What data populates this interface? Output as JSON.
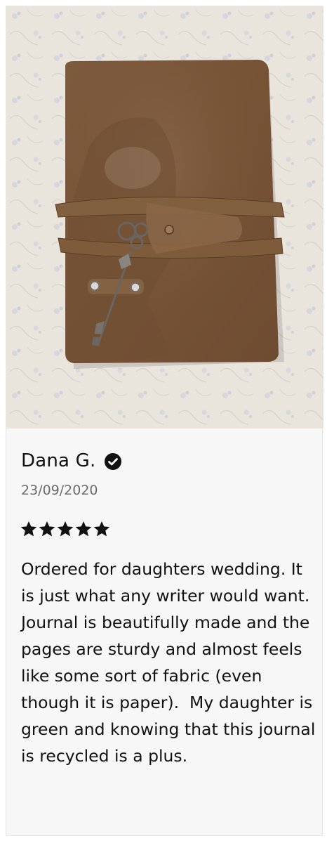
{
  "review": {
    "photo_alt": "Brown leather journal with key wrap",
    "reviewer_name": "Dana G.",
    "verified_icon": "verified-check-icon",
    "date": "23/09/2020",
    "rating": 5,
    "rating_max": 5,
    "star_icon": "star-icon",
    "body": "Ordered for daughters wedding. It is just what any writer would want. Journal is beautifully made and the pages are sturdy and almost feels like some sort of fabric (even though it is paper).  My daughter is green and knowing that this journal is recycled is a plus."
  },
  "colors": {
    "card_bg": "#f7f7f7",
    "text": "#111111",
    "date": "#6b6b6b",
    "star": "#111111",
    "leather": "#7a5638"
  }
}
